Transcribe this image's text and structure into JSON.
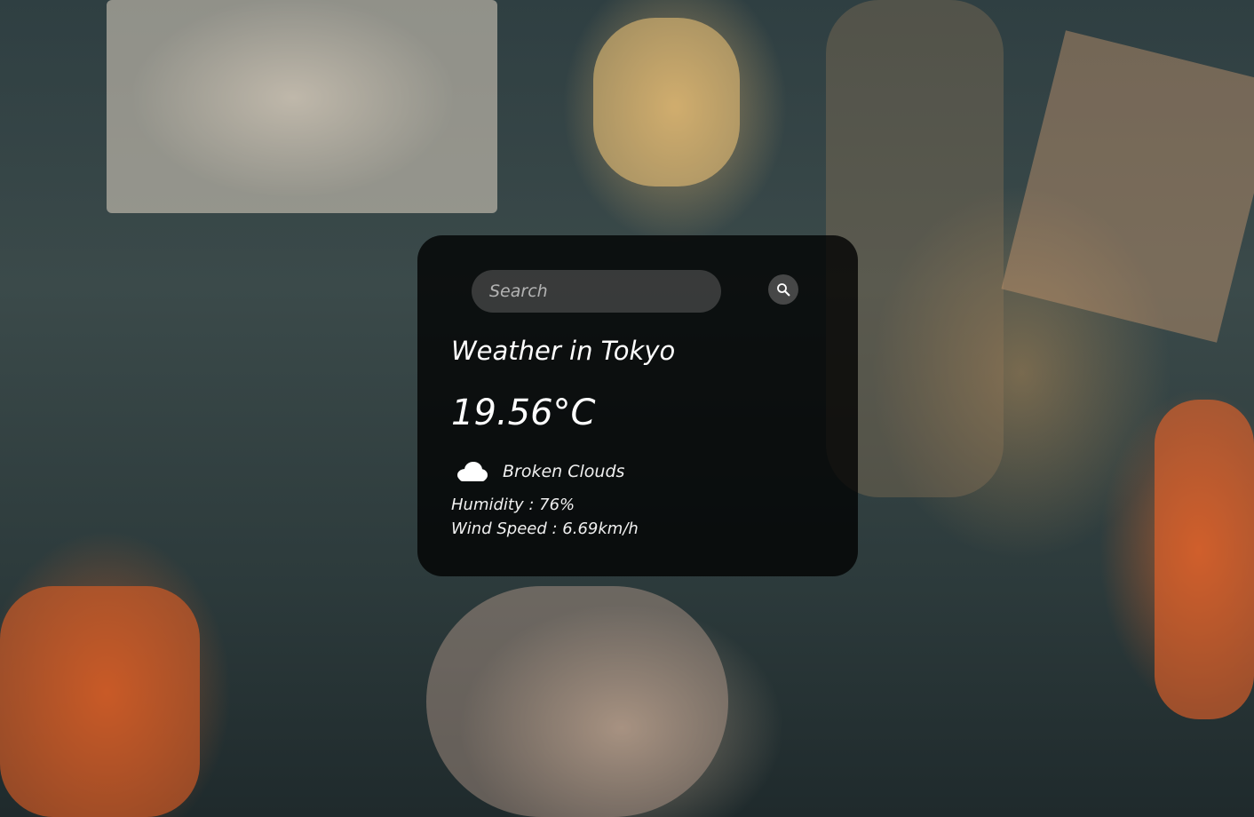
{
  "search": {
    "placeholder": "Search",
    "value": ""
  },
  "weather": {
    "title": "Weather in Tokyo",
    "temperature": "19.56°C",
    "description": "Broken Clouds",
    "humidity_label": "Humidity : ",
    "humidity_value": "76%",
    "wind_label": "Wind Speed : ",
    "wind_value": "6.69km/h",
    "condition_icon": "broken-clouds-icon"
  },
  "icons": {
    "search": "search-icon",
    "condition": "cloud-icon"
  },
  "colors": {
    "card_background": "#000000",
    "text": "#ffffff",
    "search_field": "#6e6e6e",
    "search_button": "#5a5a5a"
  }
}
